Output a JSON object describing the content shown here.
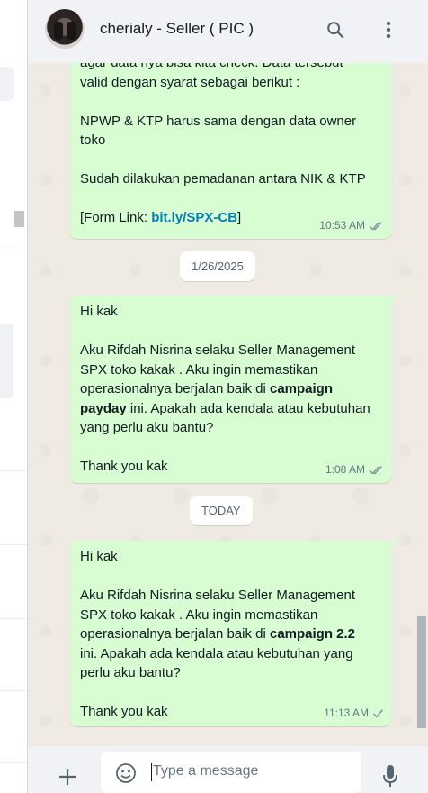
{
  "header": {
    "contact_name": "cherialy - Seller ( PIC )",
    "icons": [
      "avatar",
      "search-icon",
      "more-vertical-icon"
    ]
  },
  "messages": [
    {
      "text": "agar data nya bisa kita check. Data tersebut\nvalid dengan syarat sebagai berikut :\n\nNPWP & KTP harus sama dengan data owner\ntoko\n\nSudah dilakukan pemadanan antara NIK & KTP\n\n",
      "form_prefix": "[Form Link: ",
      "form_link": "bit.ly/SPX-CB",
      "form_suffix": "]",
      "time": "10:53 AM",
      "status": "read"
    },
    {
      "date_chip": "1/26/2025"
    },
    {
      "text_a": "Hi kak\n\nAku Rifdah Nisrina selaku Seller Management\nSPX toko kakak . Aku ingin memastikan\noperasionalnya berjalan baik di ",
      "bold_a": "campaign",
      "bold_b": "payday",
      "text_b": " ini. Apakah ada kendala atau kebutuhan\nyang perlu aku bantu?\n\nThank you kak",
      "time": "1:08 AM",
      "status": "read"
    },
    {
      "date_chip": "TODAY"
    },
    {
      "text_a": "Hi kak\n\nAku Rifdah Nisrina selaku Seller Management\nSPX toko kakak . Aku ingin memastikan\noperasionalnya berjalan baik di ",
      "bold_a": "campaign 2.2",
      "text_b": "ini. Apakah ada kendala atau kebutuhan yang\nperlu aku bantu?\n\nThank you kak",
      "time": "11:13 AM",
      "status": "sent"
    }
  ],
  "footer": {
    "placeholder": "Type a message",
    "icons": [
      "plus-icon",
      "emoji-icon",
      "microphone-icon"
    ]
  },
  "colors": {
    "bubble_out": "#d9fdd3",
    "chat_bg": "#efeae2",
    "header_bg": "#f0f2f5",
    "link": "#027eb5",
    "meta": "#667781"
  }
}
